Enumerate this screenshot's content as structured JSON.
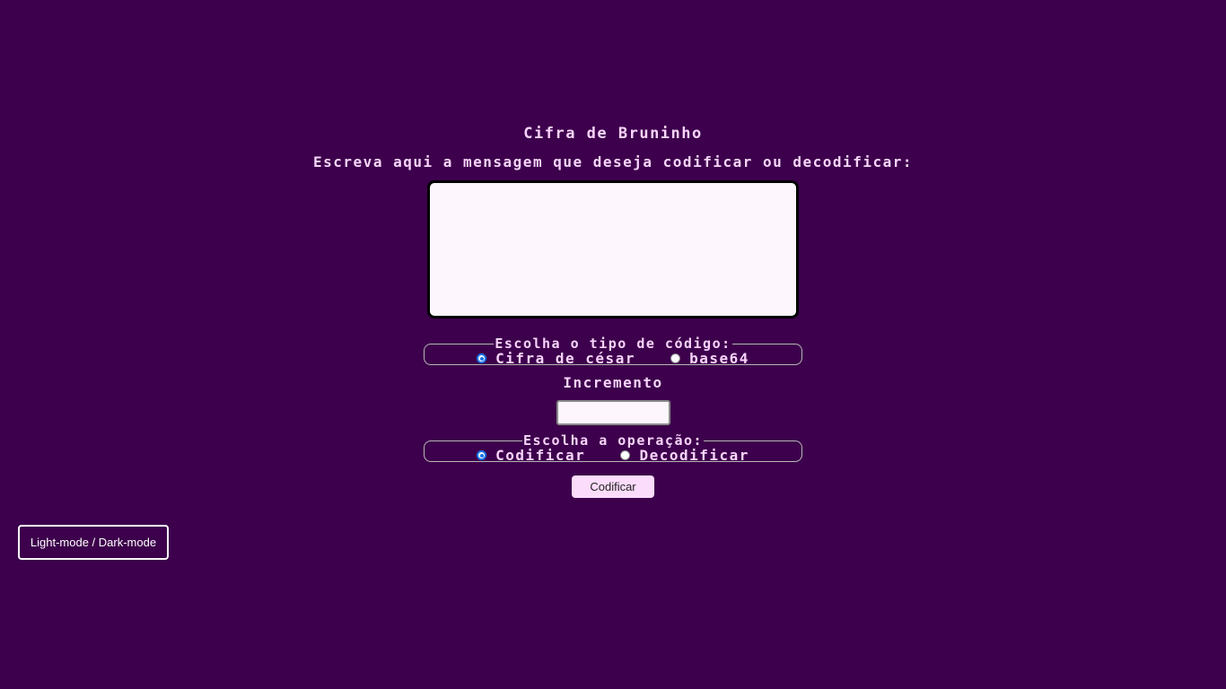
{
  "app": {
    "title": "Cifra de Bruninho",
    "prompt": "Escreva aqui a mensagem que deseja codificar ou decodificar:"
  },
  "message": {
    "value": "",
    "placeholder": ""
  },
  "code_type": {
    "legend": "Escolha o tipo de código:",
    "options": [
      {
        "label": "Cifra de césar",
        "checked": true
      },
      {
        "label": "base64",
        "checked": false
      }
    ]
  },
  "increment": {
    "label": "Incremento",
    "value": ""
  },
  "operation": {
    "legend": "Escolha a operação:",
    "options": [
      {
        "label": "Codificar",
        "checked": true
      },
      {
        "label": "Decodificar",
        "checked": false
      }
    ]
  },
  "actions": {
    "submit_label": "Codificar",
    "theme_toggle_label": "Light-mode / Dark-mode"
  },
  "colors": {
    "background": "#3d004c",
    "text": "#f8d4fb",
    "field_background": "#fdf6fd",
    "button_background": "#fbdcfb",
    "radio_accent": "#1a73e8"
  }
}
